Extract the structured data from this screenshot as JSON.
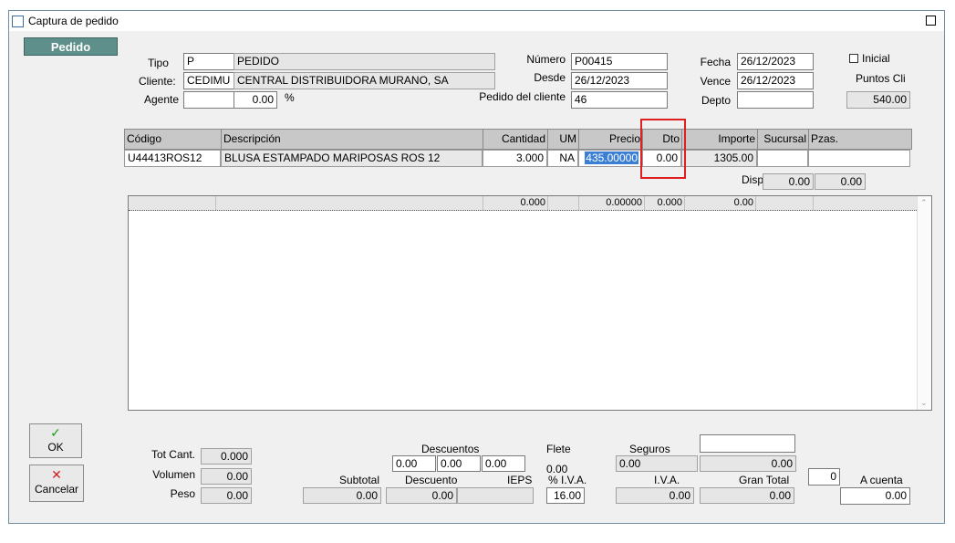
{
  "window": {
    "title": "Captura de pedido"
  },
  "header": {
    "pedido_button": "Pedido",
    "tipo_label": "Tipo",
    "tipo_code": "P",
    "tipo_desc": "PEDIDO",
    "cliente_label": "Cliente:",
    "cliente_code": "CEDIMU",
    "cliente_name": "CENTRAL DISTRIBUIDORA MURANO, SA",
    "agente_label": "Agente",
    "agente_code": "",
    "agente_pct": "0.00",
    "pct_symbol": "%",
    "numero_label": "Número",
    "numero": "P00415",
    "desde_label": "Desde",
    "desde": "26/12/2023",
    "pedido_cliente_label": "Pedido del cliente",
    "pedido_cliente": "46",
    "fecha_label": "Fecha",
    "fecha": "26/12/2023",
    "vence_label": "Vence",
    "vence": "26/12/2023",
    "depto_label": "Depto",
    "depto": "",
    "inicial_label": "Inicial",
    "puntos_label": "Puntos Cli",
    "puntos": "540.00"
  },
  "grid": {
    "columns": [
      "Código",
      "Descripción",
      "Cantidad",
      "UM",
      "Precio",
      "Dto",
      "Importe",
      "Sucursal",
      "Pzas."
    ],
    "row": {
      "codigo": "U44413ROS12",
      "descripcion": "BLUSA ESTAMPADO MARIPOSAS ROS 12",
      "cantidad": "3.000",
      "um": "NA",
      "precio": "435.00000",
      "dto": "0.00",
      "importe": "1305.00",
      "sucursal": "",
      "pzas": ""
    },
    "disp_label": "Disp",
    "disp_1": "0.00",
    "disp_2": "0.00"
  },
  "list_totals": {
    "cantidad": "0.000",
    "precio": "0.00000",
    "dto": "0.000",
    "importe": "0.00"
  },
  "actions": {
    "ok_label": "OK",
    "cancel_label": "Cancelar"
  },
  "footer": {
    "tot_cant_label": "Tot Cant.",
    "tot_cant": "0.000",
    "volumen_label": "Volumen",
    "volumen": "0.00",
    "peso_label": "Peso",
    "peso": "0.00",
    "subtotal_label": "Subtotal",
    "subtotal": "0.00",
    "descuentos_label": "Descuentos",
    "desc_1": "0.00",
    "desc_2": "0.00",
    "desc_3": "0.00",
    "descuento_label": "Descuento",
    "descuento": "0.00",
    "ieps_label": "IEPS",
    "ieps": "",
    "flete_label": "Flete",
    "flete": "0.00",
    "pct_iva_label": "% I.V.A.",
    "pct_iva": "16.00",
    "seguros_label": "Seguros",
    "seguros": "0.00",
    "iva_label": "I.V.A.",
    "iva": "0.00",
    "extra_field": "",
    "extra_value": "0.00",
    "gran_total_label": "Gran Total",
    "gran_total": "0.00",
    "count_field": "0",
    "a_cuenta_label": "A cuenta",
    "a_cuenta": "0.00"
  }
}
